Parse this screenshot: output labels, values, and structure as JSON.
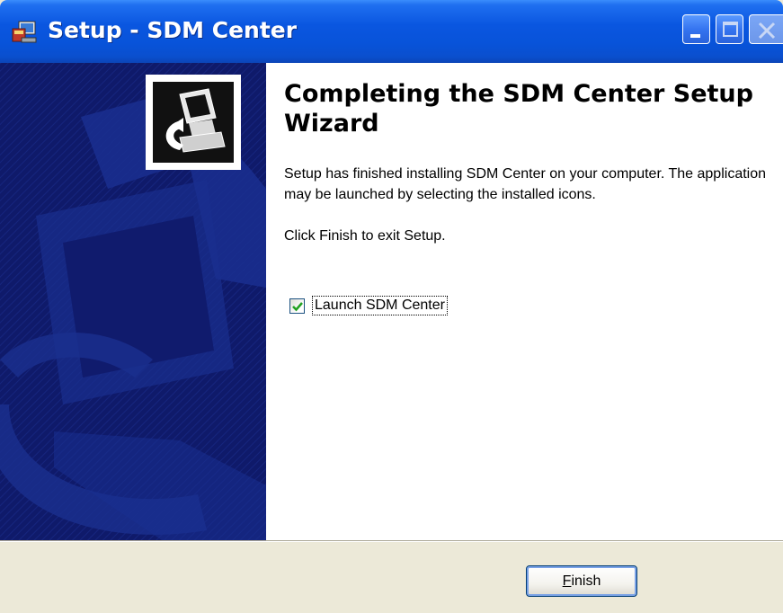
{
  "window": {
    "title": "Setup - SDM Center",
    "accent_color": "#0a56e0",
    "banner_color": "#0f1a6a"
  },
  "titlebar_buttons": {
    "minimize_icon": "minimize-icon",
    "maximize_icon": "maximize-icon",
    "close_icon": "close-icon"
  },
  "banner": {
    "icon": "computer-setup-icon"
  },
  "content": {
    "heading": "Completing the SDM Center Setup Wizard",
    "message": "Setup has finished installing SDM Center on your computer. The application may be launched by selecting the installed icons.",
    "instruction": "Click Finish to exit Setup.",
    "launch_checkbox": {
      "label": "Launch SDM Center",
      "checked": true
    }
  },
  "footer": {
    "finish_mnemonic": "F",
    "finish_rest": "inish"
  }
}
